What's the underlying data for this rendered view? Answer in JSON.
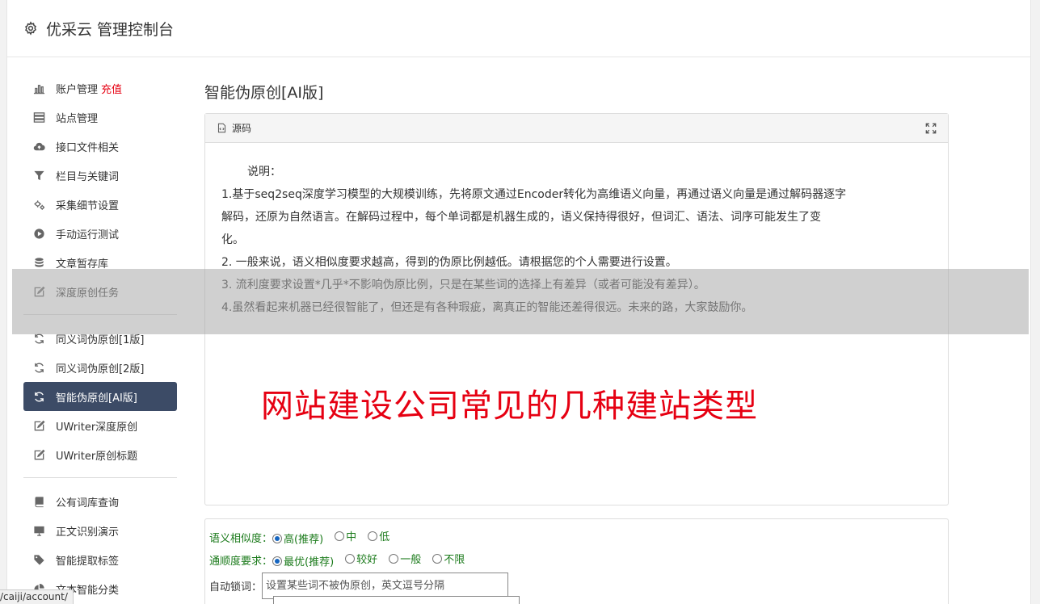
{
  "header": {
    "title": "优采云 管理控制台",
    "icon": "gear-icon"
  },
  "sidebar": {
    "group1": [
      {
        "label": "账户管理",
        "badge": "充值",
        "icon": "bar-chart-icon"
      },
      {
        "label": "站点管理",
        "icon": "server-icon"
      },
      {
        "label": "接口文件相关",
        "icon": "cloud-upload-icon"
      },
      {
        "label": "栏目与关键词",
        "icon": "filter-icon"
      },
      {
        "label": "采集细节设置",
        "icon": "cogs-icon"
      },
      {
        "label": "手动运行测试",
        "icon": "play-circle-icon"
      },
      {
        "label": "文章暂存库",
        "icon": "database-icon"
      },
      {
        "label": "深度原创任务",
        "icon": "edit-icon"
      }
    ],
    "group2": [
      {
        "label": "同义词伪原创[1版]",
        "icon": "refresh-icon"
      },
      {
        "label": "同义词伪原创[2版]",
        "icon": "refresh-icon"
      },
      {
        "label": "智能伪原创[AI版]",
        "icon": "refresh-icon",
        "active": true
      },
      {
        "label": "UWriter深度原创",
        "icon": "edit-icon"
      },
      {
        "label": "UWriter原创标题",
        "icon": "edit-icon"
      }
    ],
    "group3": [
      {
        "label": "公有词库查询",
        "icon": "book-icon"
      },
      {
        "label": "正文识别演示",
        "icon": "monitor-icon"
      },
      {
        "label": "智能提取标签",
        "icon": "tag-icon"
      },
      {
        "label": "文本智能分类",
        "icon": "pie-chart-icon"
      }
    ]
  },
  "main": {
    "title": "智能伪原创[AI版]",
    "editor": {
      "toolbar_label": "源码",
      "intro": "说明：",
      "lines": [
        "1.基于seq2seq深度学习模型的大规模训练，先将原文通过Encoder转化为高维语义向量，再通过语义向量是通过解码器逐字",
        "解码，还原为自然语言。在解码过程中，每个单词都是机器生成的，语义保持得很好，但词汇、语法、词序可能发生了变",
        "化。",
        "2. 一般来说，语义相似度要求越高，得到的伪原比例越低。请根据您的个人需要进行设置。",
        "3. 流利度要求设置*几乎*不影响伪原比例，只是在某些词的选择上有差异（或者可能没有差异）。",
        "4.虽然看起来机器已经很智能了，但还是有各种瑕疵，离真正的智能还差得很远。未来的路，大家鼓励你。"
      ]
    }
  },
  "watermark": "网站建设公司常见的几种建站类型",
  "form": {
    "similarity": {
      "label": "语义相似度：",
      "options": [
        "高(推荐)",
        "中",
        "低"
      ],
      "selected": 0
    },
    "fluency": {
      "label": "通顺度要求：",
      "options": [
        "最优(推荐)",
        "较好",
        "一般",
        "不限"
      ],
      "selected": 0
    },
    "lock": {
      "label": "自动锁词：",
      "placeholder": "设置某些词不被伪原创，英文逗号分隔"
    }
  },
  "status_url": "/caiji/account/",
  "colors": {
    "active_bg": "#3c4b66",
    "accent_red": "#e60012",
    "label_green": "#1a7a1a",
    "radio_blue": "#1565c0"
  }
}
